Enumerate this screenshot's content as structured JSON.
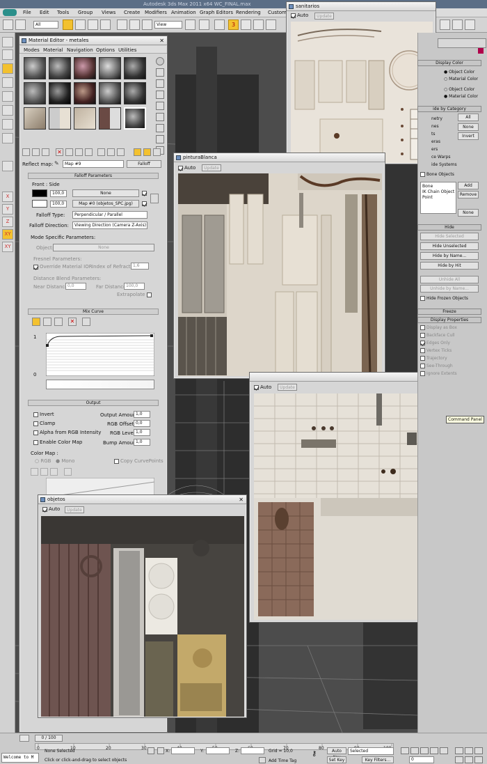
{
  "app": {
    "title": "Autodesk 3ds Max  2011 x64     WC_FINAL.max"
  },
  "menu": [
    "File",
    "Edit",
    "Tools",
    "Group",
    "Views",
    "Create",
    "Modifiers",
    "Animation",
    "Graph Editors",
    "Rendering",
    "Customi"
  ],
  "toolbar": {
    "filter": "All",
    "view": "View",
    "snap": "3"
  },
  "left_tools": [
    "X",
    "Y",
    "Z",
    "XY",
    "XY"
  ],
  "material_editor": {
    "title": "Material Editor - metales",
    "menu": [
      "Modes",
      "Material",
      "Navigation",
      "Options",
      "Utilities"
    ],
    "reflect_label": "Reflect map:",
    "map_name": "Map #9",
    "map_type": "Falloff",
    "falloff_params": "Falloff Parameters",
    "front_side": "Front : Side",
    "val1": "100,0",
    "val2": "100,0",
    "none": "None",
    "map0": "Map #0 (objetos_SPC.jpg)",
    "falloff_type_label": "Falloff Type:",
    "falloff_type": "Perpendicular / Parallel",
    "falloff_dir_label": "Falloff Direction:",
    "falloff_dir": "Viewing Direction (Camera Z-Axis)",
    "mode_specific": "Mode Specific Parameters:",
    "object_label": "Object:",
    "object_val": "None",
    "fresnel": "Fresnel Parameters:",
    "override": "Override Material IOR",
    "ior_label": "Index of Refraction",
    "ior": "1,6",
    "distance": "Distance Blend Parameters:",
    "near": "Near Distance:",
    "near_val": "0,0",
    "far": "Far Distance:",
    "far_val": "100,0",
    "extrapolate": "Extrapolate",
    "mix_curve": "Mix Curve",
    "curve_y1": "1",
    "curve_y0": "0",
    "output": "Output",
    "invert": "Invert",
    "clamp": "Clamp",
    "alpha_rgb": "Alpha from RGB Intensity",
    "enable_color_map": "Enable Color Map",
    "output_amount": "Output Amount:",
    "output_amount_v": "1,0",
    "rgb_offset": "RGB Offset:",
    "rgb_offset_v": "0,0",
    "rgb_level": "RGB Level:",
    "rgb_level_v": "1,0",
    "bump_amount": "Bump Amount:",
    "bump_amount_v": "1,0",
    "color_map": "Color Map :",
    "rgb": "RGB",
    "mono": "Mono",
    "copy_curve": "Copy CurvePoints"
  },
  "windows": {
    "sanitarios": {
      "title": "sanitarios",
      "auto": "Auto",
      "update": "Update"
    },
    "pintura": {
      "title": "pinturaBlanca",
      "auto": "Auto",
      "update": "Update"
    },
    "tiles": {
      "title": "",
      "auto": "Auto",
      "update": "Update"
    },
    "objetos": {
      "title": "objetos",
      "auto": "Auto",
      "update": "Update"
    }
  },
  "tooltip": "Command Panel",
  "command_panel": {
    "display_color": "Display Color",
    "object_color": "Object Color",
    "material_color": "Material Color",
    "object_color2": "Object Color",
    "material_color2": "Material Color",
    "by_category": "ide by Category",
    "cats": [
      "netry",
      "nes",
      "ts",
      "eras",
      "ers",
      "ce Warps",
      "ide Systems"
    ],
    "all": "All",
    "none": "None",
    "invert": "Invert",
    "bone_objects": "Bone Objects",
    "list": [
      "Bone",
      "IK Chain Object",
      "Point"
    ],
    "add": "Add",
    "remove": "Remove",
    "none2": "None",
    "hide": "Hide",
    "hide_selected": "Hide Selected",
    "hide_unselected": "Hide Unselected",
    "hide_by_name": "Hide by Name...",
    "hide_by_hit": "Hide by Hit",
    "unhide_all": "Unhide All",
    "unhide_by_name": "Unhide by Name...",
    "hide_frozen": "Hide Frozen Objects",
    "freeze": "Freeze",
    "display_props": "Display Properties",
    "props": [
      "Display as Box",
      "Backface Cull",
      "Edges Only",
      "Vertex Ticks",
      "Trajectory",
      "See-Through",
      "Ignore Extents"
    ]
  },
  "status": {
    "frame": "0 / 100",
    "ticks": [
      "0",
      "10",
      "20",
      "30",
      "40",
      "50",
      "60",
      "70",
      "80",
      "90",
      "100"
    ],
    "listener": "Welcome to M",
    "none_selected": "None Selected",
    "prompt": "Click or click-and-drag to select objects",
    "x": "X:",
    "y": "Y:",
    "z": "Z:",
    "grid": "Grid = 10,0",
    "add_time_tag": "Add Time Tag",
    "auto_key": "Auto Key",
    "selected": "Selected",
    "set_key": "Set Key",
    "key_filters": "Key Filters...",
    "frame_field": "0"
  }
}
